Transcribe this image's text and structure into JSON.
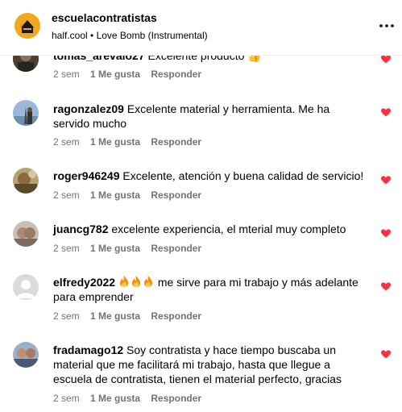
{
  "header": {
    "account": "escuelacontratistas",
    "audio": "half.cool • Love Bomb (Instrumental)"
  },
  "comments": [
    {
      "user": "tomas_arevalo27",
      "text": "Excelente producto",
      "time": "2 sem",
      "likes": "1 Me gusta",
      "reply": "Responder"
    },
    {
      "user": "ragonzalez09",
      "text": "Excelente material y herramienta. Me ha servido mucho",
      "time": "2 sem",
      "likes": "1 Me gusta",
      "reply": "Responder"
    },
    {
      "user": "roger946249",
      "text": "Excelente, atención y buena calidad de servicio!",
      "time": "2 sem",
      "likes": "1 Me gusta",
      "reply": "Responder"
    },
    {
      "user": "juancg782",
      "text": "excelente experiencia, el mterial muy completo",
      "time": "2 sem",
      "likes": "1 Me gusta",
      "reply": "Responder"
    },
    {
      "user": "elfredy2022",
      "text": "me sirve para mi trabajo y más adelante para emprender",
      "emoji": "fire-icon x3",
      "time": "2 sem",
      "likes": "1 Me gusta",
      "reply": "Responder"
    },
    {
      "user": "fradamago12",
      "text": "Soy contratista y hace tiempo buscaba un material que me facilitará mi trabajo, hasta que llegue a escuela de contratista, tienen el material perfecto, gracias",
      "time": "2 sem",
      "likes": "1 Me gusta",
      "reply": "Responder"
    }
  ],
  "colors": {
    "heart": "#ff3040",
    "meta": "#737373",
    "logo": "#f0a820"
  }
}
